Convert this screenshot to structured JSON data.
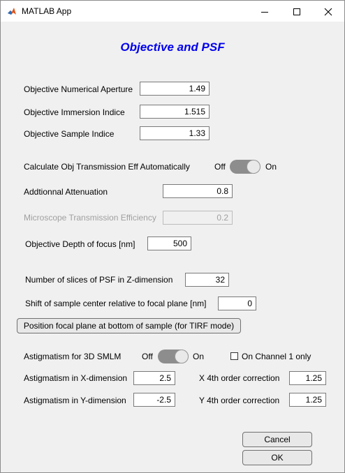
{
  "window": {
    "title": "MATLAB App",
    "icon": "matlab-icon"
  },
  "heading": "Objective and PSF",
  "objective": {
    "na_label": "Objective Numerical Aperture",
    "na_value": "1.49",
    "immersion_label": "Objective Immersion Indice",
    "immersion_value": "1.515",
    "sample_label": "Objective Sample Indice",
    "sample_value": "1.33"
  },
  "transmission": {
    "calc_label": "Calculate Obj Transmission Eff Automatically",
    "off": "Off",
    "on": "On",
    "attenuation_label": "Addtionnal Attenuation",
    "attenuation_value": "0.8",
    "efficiency_label": "Microscope Transmission Efficiency",
    "efficiency_value": "0.2"
  },
  "depth": {
    "label": "Objective Depth of focus [nm]",
    "value": "500"
  },
  "slices": {
    "label": "Number of slices of PSF in Z-dimension",
    "value": "32"
  },
  "shift": {
    "label": "Shift of sample center relative to focal plane [nm]",
    "value": "0"
  },
  "position_button": "Position focal plane at bottom of sample (for TIRF mode)",
  "astig": {
    "label": "Astigmatism for 3D SMLM",
    "off": "Off",
    "on": "On",
    "channel_label": "On Channel 1 only",
    "x_label": "Astigmatism in X-dimension",
    "x_value": "2.5",
    "y_label": "Astigmatism in Y-dimension",
    "y_value": "-2.5",
    "x4_label": "X 4th order correction",
    "x4_value": "1.25",
    "y4_label": "Y 4th order correction",
    "y4_value": "1.25"
  },
  "buttons": {
    "cancel": "Cancel",
    "ok": "OK"
  }
}
